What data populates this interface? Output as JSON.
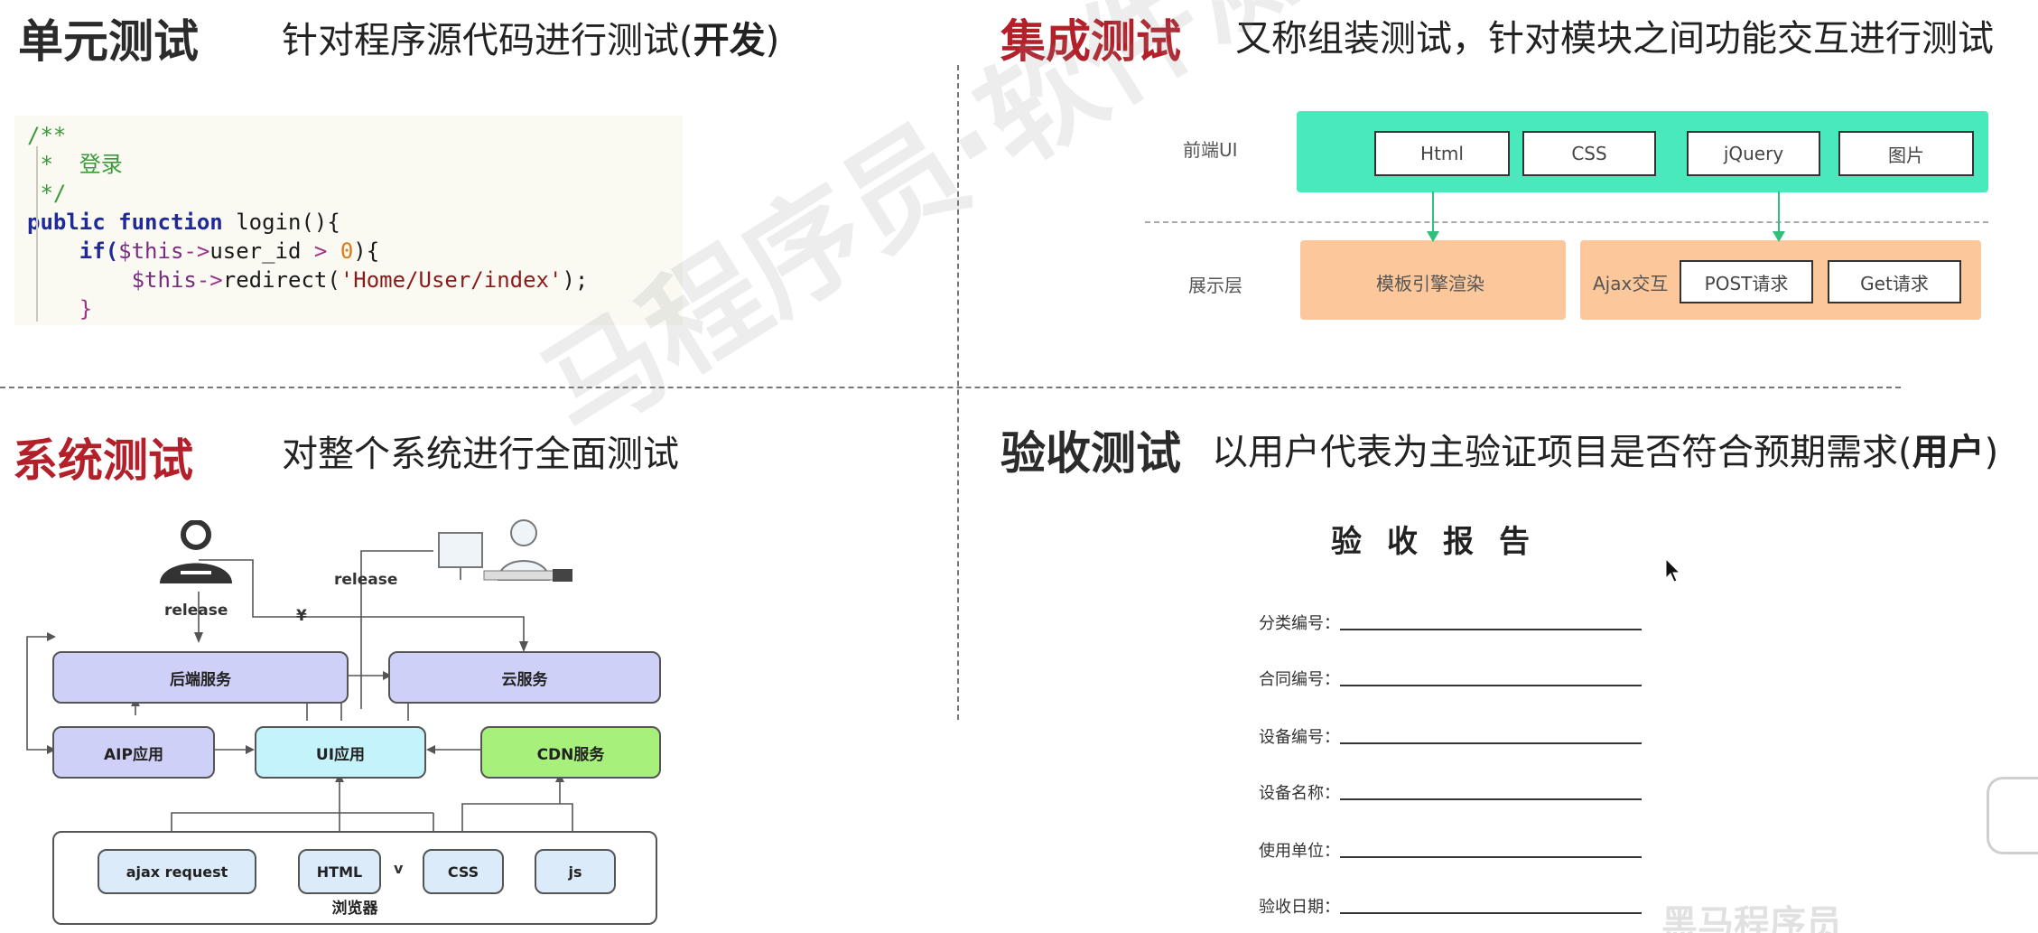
{
  "unit_test": {
    "title": "单元测试",
    "desc_prefix": "针对程序源代码进行测试(",
    "desc_bold": "开发",
    "desc_suffix": ")"
  },
  "integration_test": {
    "title": "集成测试",
    "desc": "又称组装测试，针对模块之间功能交互进行测试"
  },
  "system_test": {
    "title": "系统测试",
    "desc": "对整个系统进行全面测试"
  },
  "acceptance_test": {
    "title": "验收测试",
    "desc_prefix": "以用户代表为主验证项目是否符合预期需求(",
    "desc_bold": "用户",
    "desc_suffix": ")"
  },
  "code": {
    "line1": "/**",
    "line2": " *  登录",
    "line3": " */",
    "kw_public": "public",
    "kw_function": "function",
    "fn_name": "login(){",
    "kw_if": "if(",
    "var_this1": "$this",
    "arrow1": "->",
    "prop": "user_id",
    "gt": " > ",
    "zero": "0",
    "if_close": "){",
    "var_this2": "$this",
    "arrow2": "->",
    "redirect": "redirect(",
    "str": "'Home/User/index'",
    "redirect_close": ");",
    "brace": "}"
  },
  "integration": {
    "frontend_label": "前端UI",
    "display_label": "展示层",
    "boxes": [
      "Html",
      "CSS",
      "jQuery",
      "图片"
    ],
    "template_render": "模板引擎渲染",
    "ajax_label": "Ajax交互",
    "post": "POST请求",
    "get": "Get请求"
  },
  "system": {
    "release1": "release",
    "release2": "release",
    "yen": "¥",
    "backend": "后端服务",
    "cloud": "云服务",
    "aip": "AIP应用",
    "ui": "UI应用",
    "cdn": "CDN服务",
    "ajax": "ajax request",
    "html": "HTML",
    "v": "v",
    "css": "CSS",
    "js": "js",
    "browser": "浏览器"
  },
  "report": {
    "title": "验收报告",
    "fields": [
      "分类编号：",
      "合同编号：",
      "设备编号：",
      "设备名称：",
      "使用单位：",
      "验收日期："
    ]
  },
  "watermark": "马程序员·软件测试",
  "brand": "黑马程序员"
}
